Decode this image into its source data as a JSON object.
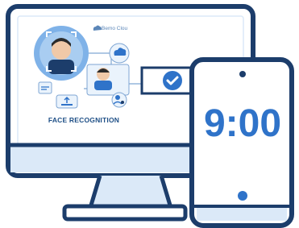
{
  "illustration": {
    "brand_text": "Bemo Clou",
    "caption": "FACE RECOGNITION",
    "phone_time": "9:00",
    "icons": [
      "monitor-icon",
      "phone-icon",
      "face-scan-icon",
      "cloud-icon",
      "checkmark-icon",
      "user-settings-icon",
      "cloud-upload-icon",
      "cloud-logo-icon"
    ],
    "colors": {
      "navy": "#1c3d6b",
      "blue": "#2f73c9",
      "light_blue": "#dbe9f8",
      "screen": "#ffffff"
    }
  }
}
